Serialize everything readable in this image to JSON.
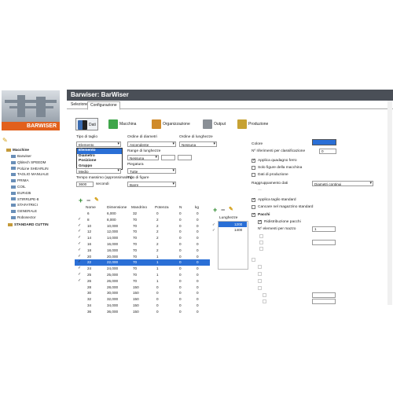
{
  "brand": "BARWISER",
  "header_title": "Barwiser: BarWiser",
  "tabs": [
    "Selezione",
    "Configurazione"
  ],
  "tree": {
    "root": "Macchine",
    "items": [
      "Barwiser",
      "Qbitech SPEEDM",
      "PolLine SHEARLIN",
      "TAGLIO MANUALE",
      "PRIMA",
      "COIL",
      "EUR435",
      "STIRRUPE-8",
      "STAFATRICI",
      "GENERALE",
      "Robosector"
    ],
    "footer": "STANDARD CUTTIN"
  },
  "toolbar": [
    "Dati",
    "Macchina",
    "Organizzazione",
    "Output",
    "Produzione"
  ],
  "form": {
    "tipo_taglio_label": "Tipo di taglio",
    "tipo_taglio_value": "Elemento",
    "tipo_options": [
      "Elemento",
      "Diametro",
      "Posizione",
      "Gruppo"
    ],
    "ordine_diametri_label": "Ordine di diametri",
    "ordine_diametri_value": "Ascendente",
    "ordine_lunghezze_label": "Ordine di lunghezze",
    "ordine_lunghezze_value": "Nessuna",
    "range_lunghezze_label": "Range di lunghezze",
    "range_value": "Nessuna",
    "media_value": "Medio",
    "piegatura_label": "Piegatura",
    "piegatura_value": "Tutte",
    "tempo_label": "Tempo massimo (approssimativo)",
    "tempo_value": "3600",
    "tempo_unit": "secondi",
    "tipo_figure_label": "Tipo di figure",
    "tipo_figure_value": "Barre"
  },
  "table": {
    "headers": [
      "Nome",
      "Dimensione",
      "Mandrino",
      "Potenza",
      "N",
      "kg"
    ],
    "rows": [
      [
        "6",
        "6,000",
        "32",
        "0",
        "0",
        "0"
      ],
      [
        "8",
        "8,000",
        "70",
        "2",
        "0",
        "0"
      ],
      [
        "10",
        "10,000",
        "70",
        "2",
        "0",
        "0"
      ],
      [
        "12",
        "12,000",
        "70",
        "2",
        "0",
        "0"
      ],
      [
        "14",
        "14,000",
        "70",
        "2",
        "0",
        "0"
      ],
      [
        "16",
        "16,000",
        "70",
        "2",
        "0",
        "0"
      ],
      [
        "18",
        "18,000",
        "70",
        "2",
        "0",
        "0"
      ],
      [
        "20",
        "20,000",
        "70",
        "1",
        "0",
        "0"
      ],
      [
        "22",
        "22,000",
        "70",
        "1",
        "0",
        "0"
      ],
      [
        "24",
        "24,000",
        "70",
        "1",
        "0",
        "0"
      ],
      [
        "25",
        "25,000",
        "70",
        "1",
        "0",
        "0"
      ],
      [
        "26",
        "26,000",
        "70",
        "1",
        "0",
        "0"
      ],
      [
        "28",
        "28,000",
        "150",
        "0",
        "0",
        "0"
      ],
      [
        "30",
        "30,000",
        "150",
        "0",
        "0",
        "0"
      ],
      [
        "32",
        "32,000",
        "150",
        "0",
        "0",
        "0"
      ],
      [
        "34",
        "34,000",
        "150",
        "0",
        "0",
        "0"
      ],
      [
        "36",
        "36,000",
        "150",
        "0",
        "0",
        "0"
      ]
    ],
    "checked": [
      false,
      true,
      true,
      true,
      true,
      true,
      true,
      true,
      true,
      true,
      true,
      true,
      false,
      false,
      false,
      false,
      false
    ],
    "highlight_index": 8
  },
  "lunghezze": {
    "label": "Lunghezze",
    "values": [
      "1200",
      "1400"
    ],
    "checked": [
      true,
      true
    ]
  },
  "right": {
    "colore_label": "Colore",
    "colore_value": "#2a6fd6",
    "riferimenti_label": "Nº riferimenti per classificazione",
    "riferimenti_value": "0",
    "options1": [
      {
        "label": "Applica quadagno ferro",
        "on": true,
        "dim": false
      },
      {
        "label": "Solo figure della macchina",
        "on": false,
        "dim": false
      },
      {
        "label": "Dati di produzione",
        "on": false,
        "dim": false
      }
    ],
    "raggruppa_label": "Raggruppamento dati",
    "raggruppa_value": "Diametri continui",
    "options2": [
      {
        "label": "Applica taglio standard",
        "on": true,
        "dim": false
      },
      {
        "label": "Cancare nel magazzino standard",
        "on": false,
        "dim": false
      }
    ],
    "pacchi_label": "Pacchi",
    "ridistribuzione_label": "Ridistribuzione pacchi",
    "elementi_label": "Nº elementi per mazzo",
    "elementi_value": "1"
  }
}
